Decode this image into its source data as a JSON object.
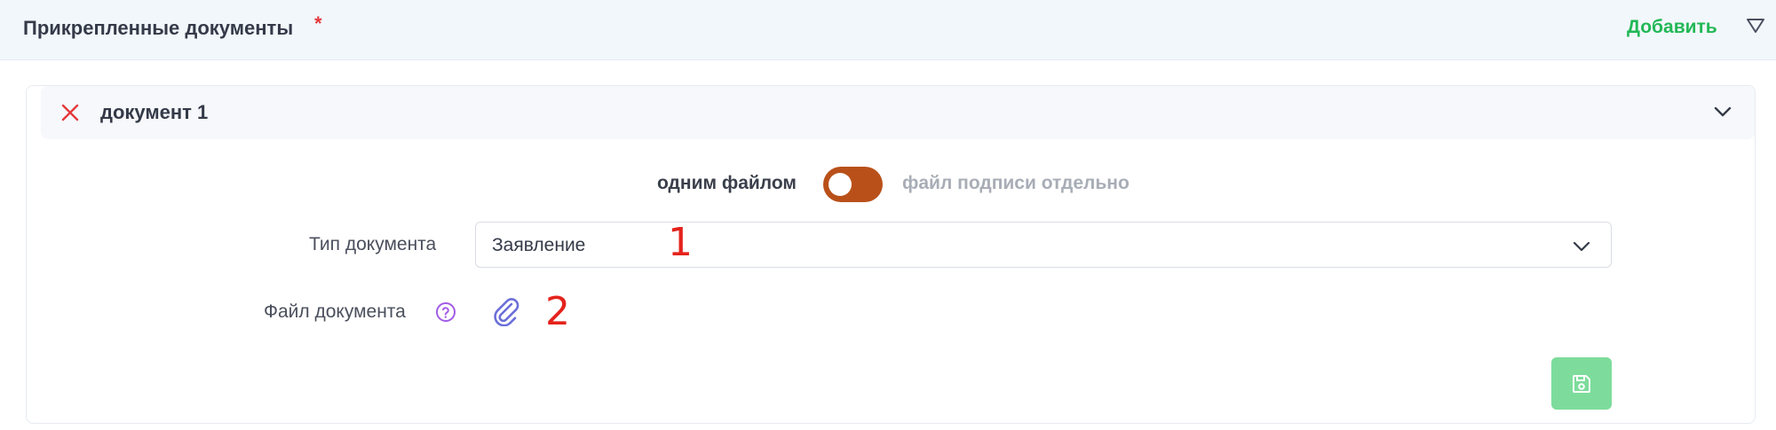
{
  "header": {
    "title": "Прикрепленные документы",
    "required_marker": "*",
    "add_label": "Добавить"
  },
  "document": {
    "title": "документ 1",
    "toggle": {
      "left_label": "одним файлом",
      "right_label": "файл подписи отдельно",
      "state": "on"
    },
    "type_field": {
      "label": "Тип документа",
      "value": "Заявление"
    },
    "file_field": {
      "label": "Файл документа"
    }
  },
  "annotations": [
    "1",
    "2"
  ],
  "colors": {
    "accent_green": "#22b856",
    "toggle_active": "#b9501a",
    "danger_red": "#e5383b",
    "save_button": "#7ddc9b",
    "help_purple": "#a35ce6",
    "attach_blue": "#6b6fd8"
  },
  "icons": [
    "triangle-down-icon",
    "close-icon",
    "chevron-down-icon",
    "help-icon",
    "paperclip-icon",
    "floppy-disk-icon"
  ]
}
